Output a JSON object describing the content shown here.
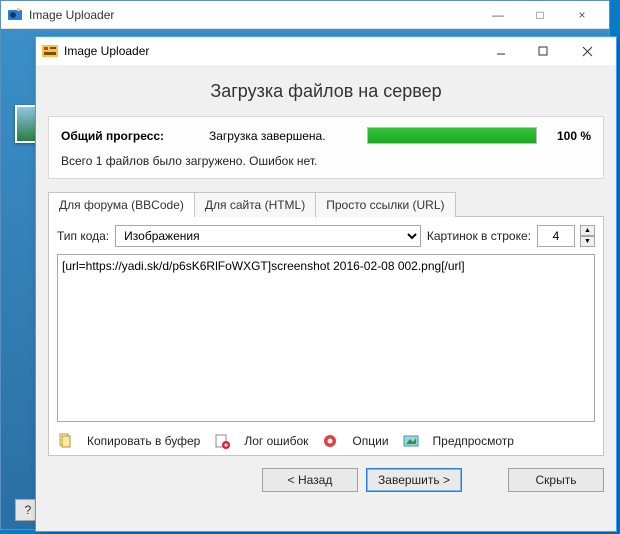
{
  "bg_window": {
    "title": "Image Uploader",
    "controls": {
      "min": "—",
      "max": "□",
      "close": "×"
    },
    "help": "?"
  },
  "dialog": {
    "title": "Image Uploader",
    "heading": "Загрузка файлов на сервер",
    "progress": {
      "label": "Общий прогресс:",
      "text": "Загрузка завершена.",
      "percent_text": "100 %",
      "percent": 100
    },
    "status": "Всего 1 файлов было загружено. Ошибок нет.",
    "tabs": [
      {
        "id": "bbcode",
        "label": "Для форума (BBCode)"
      },
      {
        "id": "html",
        "label": "Для сайта (HTML)"
      },
      {
        "id": "plain",
        "label": "Просто ссылки (URL)"
      }
    ],
    "active_tab": "bbcode",
    "code_type": {
      "label": "Тип кода:",
      "options": [
        "Изображения"
      ],
      "value": "Изображения"
    },
    "per_row": {
      "label": "Картинок в строке:",
      "value": "4"
    },
    "output": "[url=https://yadi.sk/d/p6sK6RlFoWXGT]screenshot 2016-02-08 002.png[/url]",
    "actions": {
      "copy": "Копировать в буфер",
      "log": "Лог ошибок",
      "options": "Опции",
      "preview": "Предпросмотр"
    },
    "buttons": {
      "back": "< Назад",
      "finish": "Завершить >",
      "hide": "Скрыть"
    }
  }
}
